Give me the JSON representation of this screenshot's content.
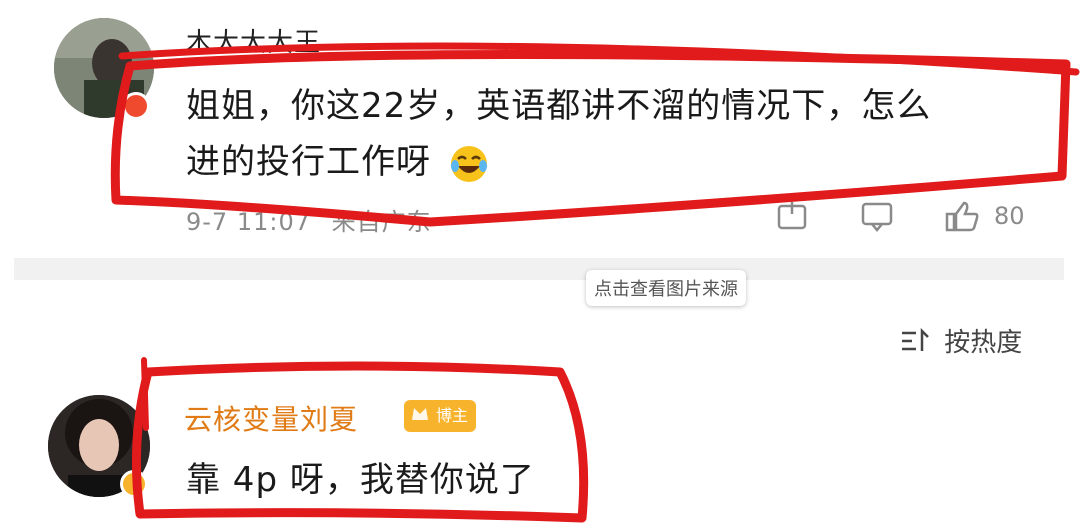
{
  "comment1": {
    "username": "木大大大王",
    "text_line1": "姐姐，你这22岁，英语都讲不溜的情况下，怎么",
    "text_line2": "进的投行工作呀",
    "emoji": "laughing-tears-emoji",
    "time": "9-7 11:07",
    "location": "来自广东",
    "like_count": "80"
  },
  "tooltip": "点击查看图片来源",
  "sort": {
    "icon": "sort-icon",
    "label": "按热度"
  },
  "comment2": {
    "username": "云核变量刘夏",
    "badge": "博主",
    "text": "靠 4p 呀，我替你说了"
  },
  "colors": {
    "accent_orange": "#e07b16",
    "badge": "#f7b32b",
    "annotation_red": "#e11b1b",
    "meta_gray": "#8a8a8a"
  }
}
